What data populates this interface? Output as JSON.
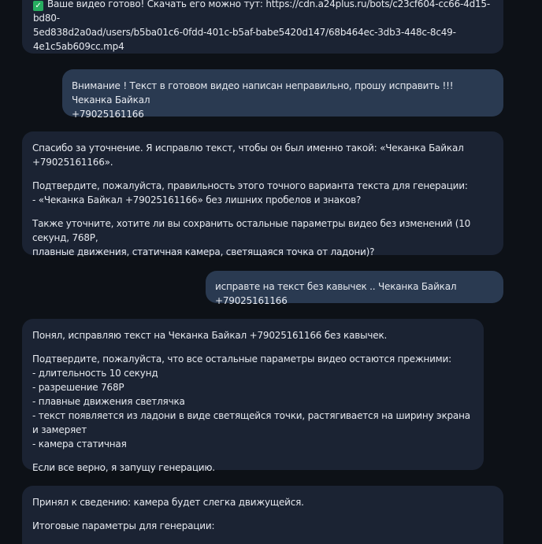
{
  "messages": {
    "m1": {
      "icon": "check-mark-icon",
      "line1": "Ваше видео готово! Скачать его можно тут: https://cdn.a24plus.ru/bots/c23cf604-cc66-4d15-bd80-",
      "line2": "5ed838d2a0ad/users/b5ba01c6-0fdd-401c-b5af-babe5420d147/68b464ec-3db3-448c-8c49-",
      "line3": "4e1c5ab609cc.mp4"
    },
    "m2": {
      "line1": "Внимание ! Текст в готовом видео написан неправильно, прошу исправить !!! Чеканка Байкал",
      "line2": "+79025161166"
    },
    "m3": {
      "p1_l1": "Спасибо за уточнение. Я исправлю текст, чтобы он был именно такой: «Чеканка Байкал",
      "p1_l2": "+79025161166».",
      "p2_l1": "Подтвердите, пожалуйста, правильность этого точного варианта текста для генерации:",
      "p2_l2": "- «Чеканка Байкал +79025161166» без лишних пробелов и знаков?",
      "p3_l1": "Также уточните, хотите ли вы сохранить остальные параметры видео без изменений (10 секунд, 768P,",
      "p3_l2": "плавные движения, статичная камера, светящаяся точка от ладони)?"
    },
    "m4": {
      "line1": "исправте на текст без кавычек .. Чеканка Байкал +79025161166"
    },
    "m5": {
      "p1": "Понял, исправляю текст на Чеканка Байкал +79025161166 без кавычек.",
      "p2": "Подтвердите, пожалуйста, что все остальные параметры видео остаются прежними:",
      "items": [
        "- длительность 10 секунд",
        "- разрешение 768P",
        "- плавные движения светлячка",
        "- текст появляется из ладони в виде светящейся точки, растягивается на ширину экрана и замеряет",
        "- камера статичная"
      ],
      "p3": "Если все верно, я запущу генерацию."
    },
    "m6": {
      "p1": "Принял к сведению: камера будет слегка движущейся.",
      "p2": "Итоговые параметры для генерации:"
    }
  },
  "colors": {
    "background": "#0d1117",
    "bot_bubble": "#1b2333",
    "user_bubble": "#2a3a51",
    "check": "#27ae60"
  }
}
